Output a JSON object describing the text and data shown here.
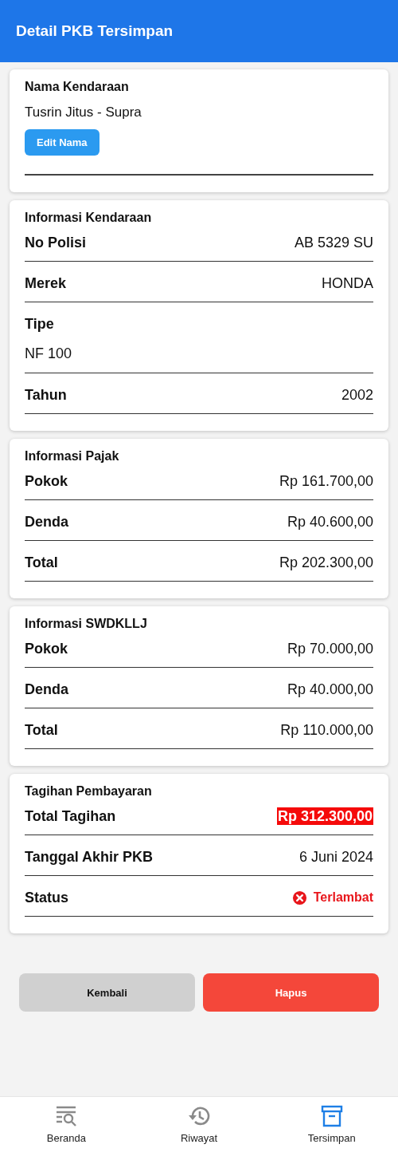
{
  "app_bar": {
    "title": "Detail PKB Tersimpan"
  },
  "name_card": {
    "title": "Nama Kendaraan",
    "value": "Tusrin Jitus - Supra",
    "button": "Edit Nama"
  },
  "sections": [
    {
      "title": "Informasi Kendaraan",
      "rows": [
        {
          "kind": "inline",
          "label": "No Polisi",
          "value": "AB 5329 SU"
        },
        {
          "kind": "inline",
          "label": "Merek",
          "value": "HONDA"
        },
        {
          "kind": "stacked",
          "label": "Tipe",
          "value": "NF 100"
        },
        {
          "kind": "inline",
          "label": "Tahun",
          "value": "2002"
        }
      ]
    },
    {
      "title": "Informasi Pajak",
      "rows": [
        {
          "kind": "inline",
          "label": "Pokok",
          "value": "Rp 161.700,00"
        },
        {
          "kind": "inline",
          "label": "Denda",
          "value": "Rp 40.600,00"
        },
        {
          "kind": "inline",
          "label": "Total",
          "value": "Rp 202.300,00"
        }
      ]
    },
    {
      "title": "Informasi SWDKLLJ",
      "rows": [
        {
          "kind": "inline",
          "label": "Pokok",
          "value": "Rp 70.000,00"
        },
        {
          "kind": "inline",
          "label": "Denda",
          "value": "Rp 40.000,00"
        },
        {
          "kind": "inline",
          "label": "Total",
          "value": "Rp 110.000,00"
        }
      ]
    },
    {
      "title": "Tagihan Pembayaran",
      "rows": [
        {
          "kind": "highlight",
          "label": "Total Tagihan",
          "value": "Rp 312.300,00"
        },
        {
          "kind": "inline",
          "label": "Tanggal Akhir PKB",
          "value": "6 Juni 2024"
        },
        {
          "kind": "status",
          "label": "Status",
          "value": "Terlambat"
        }
      ]
    }
  ],
  "actions": [
    {
      "kind": "secondary",
      "label": "Kembali"
    },
    {
      "kind": "danger",
      "label": "Hapus"
    }
  ],
  "bottom_nav": [
    {
      "kind": "search",
      "label": "Beranda",
      "selected": false
    },
    {
      "kind": "history",
      "label": "Riwayat",
      "selected": false
    },
    {
      "kind": "archive",
      "label": "Tersimpan",
      "selected": true
    }
  ]
}
